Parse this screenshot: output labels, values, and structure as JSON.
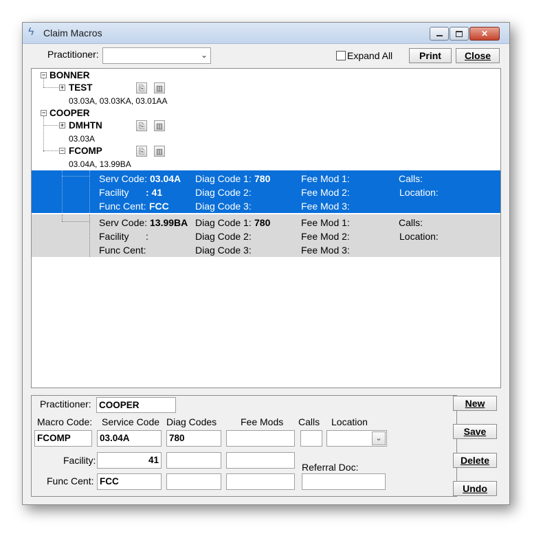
{
  "window": {
    "title": "Claim Macros"
  },
  "toolbar": {
    "practitioner_label": "Practitioner:",
    "practitioner_value": "",
    "expand_all_label": "Expand All",
    "expand_all_checked": false,
    "print_label": "Print",
    "close_label": "Close"
  },
  "tree": {
    "groups": [
      {
        "name": "BONNER",
        "macros": [
          {
            "name": "TEST",
            "codes": "03.03A, 03.03KA, 03.01AA",
            "expanded": false
          }
        ]
      },
      {
        "name": "COOPER",
        "macros": [
          {
            "name": "DMHTN",
            "codes": "03.03A",
            "expanded": false
          },
          {
            "name": "FCOMP",
            "codes": "03.04A, 13.99BA",
            "expanded": true
          }
        ]
      }
    ],
    "details": [
      {
        "serv_label": "Serv Code:",
        "serv_value": "03.04A",
        "facility_label": "Facility",
        "facility_value": ": 41",
        "func_label": "Func Cent:",
        "func_value": "FCC",
        "diag1_label": "Diag Code 1:",
        "diag1_value": "780",
        "diag2_label": "Diag Code 2:",
        "diag3_label": "Diag Code 3:",
        "fee1_label": "Fee Mod 1:",
        "fee2_label": "Fee Mod 2:",
        "fee3_label": "Fee Mod 3:",
        "calls_label": "Calls:",
        "location_label": "Location:",
        "selected": true
      },
      {
        "serv_label": "Serv Code:",
        "serv_value": "13.99BA",
        "facility_label": "Facility",
        "facility_value": ":",
        "func_label": "Func Cent:",
        "func_value": "",
        "diag1_label": "Diag Code 1:",
        "diag1_value": "780",
        "diag2_label": "Diag Code 2:",
        "diag3_label": "Diag Code 3:",
        "fee1_label": "Fee Mod 1:",
        "fee2_label": "Fee Mod 2:",
        "fee3_label": "Fee Mod 3:",
        "calls_label": "Calls:",
        "location_label": "Location:",
        "selected": false
      }
    ]
  },
  "form": {
    "practitioner_label": "Practitioner:",
    "practitioner_value": "COOPER",
    "macro_code_label": "Macro Code:",
    "macro_code_value": "FCOMP",
    "service_code_label": "Service Code",
    "service_code_value": "03.04A",
    "diag_codes_label": "Diag Codes",
    "diag_code_1": "780",
    "diag_code_2": "",
    "diag_code_3": "",
    "fee_mods_label": "Fee Mods",
    "fee_mod_1": "",
    "fee_mod_2": "",
    "fee_mod_3": "",
    "calls_label": "Calls",
    "calls_value": "",
    "location_label": "Location",
    "location_value": "",
    "facility_label": "Facility:",
    "facility_value": "41",
    "func_cent_label": "Func Cent:",
    "func_cent_value": "FCC",
    "referral_doc_label": "Referral Doc:",
    "referral_doc_value": ""
  },
  "actions": {
    "new_label": "New",
    "save_label": "Save",
    "delete_label": "Delete",
    "undo_label": "Undo"
  },
  "colors": {
    "selected_row": "#0a6fd8",
    "alt_row": "#d9d9d9"
  }
}
